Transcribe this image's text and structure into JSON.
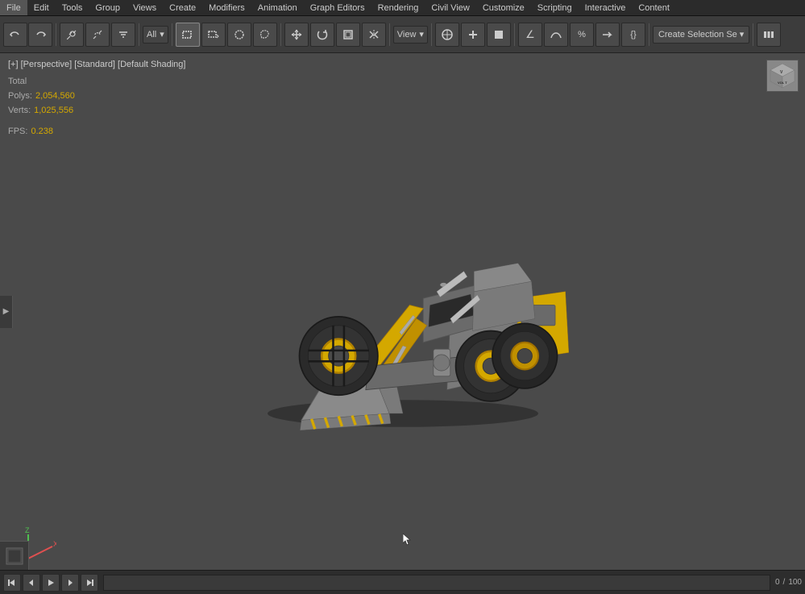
{
  "menubar": {
    "items": [
      "File",
      "Edit",
      "Tools",
      "Group",
      "Views",
      "Create",
      "Modifiers",
      "Animation",
      "Graph Editors",
      "Rendering",
      "Civil View",
      "Customize",
      "Scripting",
      "Interactive",
      "Content"
    ]
  },
  "toolbar": {
    "undo_label": "↩",
    "redo_label": "↪",
    "link_label": "🔗",
    "unlink_label": "",
    "filter_label": "≈",
    "mode_dropdown": "All",
    "select_rect": "▭",
    "select_options": "▭▾",
    "select_circle": "○",
    "select_lasso": "⌘",
    "move_label": "+",
    "rotate_label": "↻",
    "scale_label": "⬜",
    "mirror_label": "⊿",
    "view_dropdown": "View",
    "link2_label": "⊕",
    "plus_label": "+",
    "box_label": "⬛",
    "angle_label": "∠",
    "curve_label": "〜",
    "percent_label": "%",
    "arrow_label": "→",
    "bracket_label": "{}",
    "create_selection": "Create Selection Se",
    "dropdown_arrow": "▾",
    "more_label": "|||"
  },
  "viewport": {
    "label": "[+] [Perspective] [Standard] [Default Shading]",
    "stats": {
      "polys_label": "Polys:",
      "polys_value": "2,054,560",
      "verts_label": "Verts:",
      "verts_value": "1,025,556",
      "total_label": "Total",
      "fps_label": "FPS:",
      "fps_value": "0.238"
    },
    "cube_label": "VOL T"
  },
  "bottom_panel": {
    "play": "▶",
    "prev": "◀",
    "next": "▶",
    "start_frame": "0",
    "end_frame": "100",
    "current_frame": "0"
  },
  "axis": {
    "x_color": "#e05050",
    "y_color": "#50c050",
    "z_color": "#5080e0"
  }
}
